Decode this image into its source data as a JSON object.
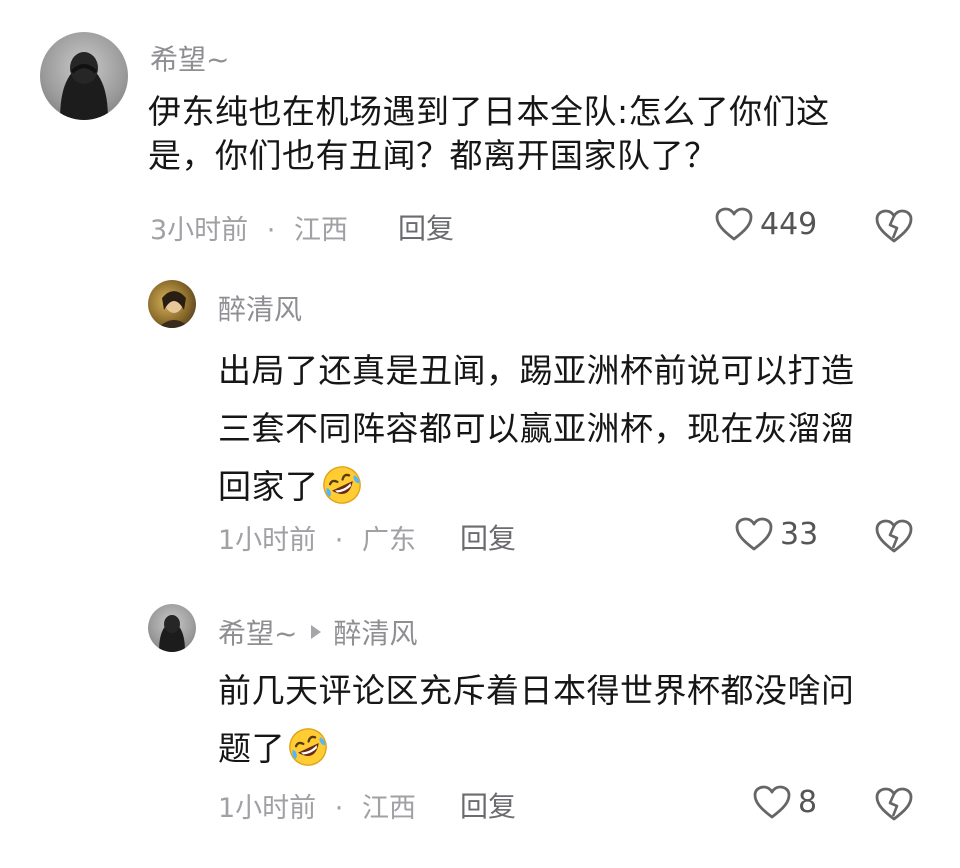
{
  "comments": [
    {
      "author": "希望~",
      "text": "伊东纯也在机场遇到了日本全队:怎么了你们这是，你们也有丑闻？都离开国家队了？",
      "text_lines": [
        "伊东纯也在机场遇到了日本全队:怎么了你们这",
        "是，你们也有丑闻？都离开国家队了？"
      ],
      "time": "3小时前",
      "location": "江西",
      "reply_label": "回复",
      "likes": "449"
    },
    {
      "author": "醉清风",
      "text_lines": [
        "出局了还真是丑闻，踢亚洲杯前说可以打造",
        "三套不同阵容都可以赢亚洲杯，现在灰溜溜",
        "回家了"
      ],
      "emoji": "rolling-on-floor-laughing",
      "time": "1小时前",
      "location": "广东",
      "reply_label": "回复",
      "likes": "33"
    },
    {
      "author": "希望~",
      "reply_to": "醉清风",
      "text_lines": [
        "前几天评论区充斥着日本得世界杯都没啥问",
        "题了"
      ],
      "emoji": "rolling-on-floor-laughing",
      "time": "1小时前",
      "location": "江西",
      "reply_label": "回复",
      "likes": "8"
    }
  ],
  "separator": "·"
}
